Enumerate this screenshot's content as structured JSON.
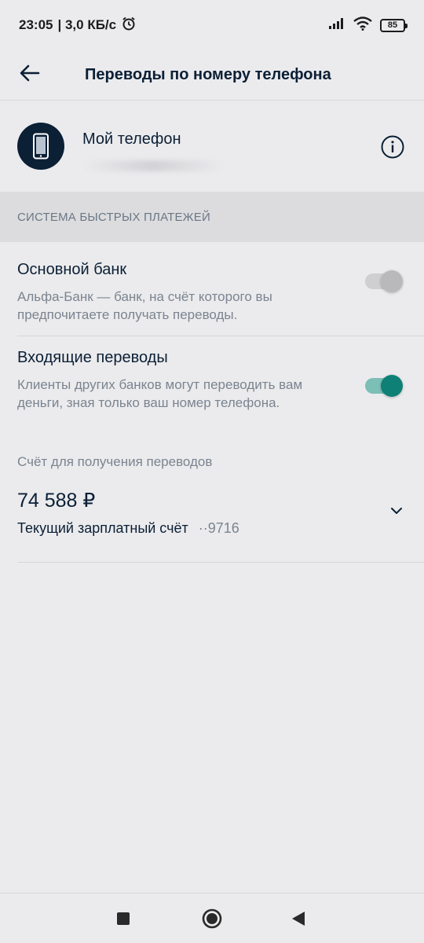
{
  "status_bar": {
    "time": "23:05",
    "speed": "| 3,0 КБ/с",
    "battery": "85",
    "icons": [
      "alarm-icon",
      "signal-icon",
      "wifi-icon",
      "battery-icon"
    ]
  },
  "header": {
    "title": "Переводы по номеру телефона",
    "back_icon": "arrow-left-icon"
  },
  "phone": {
    "title": "Мой телефон",
    "icon": "smartphone-icon",
    "info_icon": "info-icon"
  },
  "section": {
    "title": "СИСТЕМА БЫСТРЫХ ПЛАТЕЖЕЙ"
  },
  "settings": [
    {
      "title": "Основной банк",
      "description": "Альфа-Банк — банк, на счёт которого вы предпочитаете получать переводы.",
      "enabled": false
    },
    {
      "title": "Входящие переводы",
      "description": "Клиенты других банков могут переводить вам деньги, зная только ваш номер телефона.",
      "enabled": true
    }
  ],
  "account": {
    "label": "Счёт для получения переводов",
    "amount": "74 588 ₽",
    "name": "Текущий зарплатный счёт",
    "mask": "··9716"
  },
  "colors": {
    "accent": "#0f8075",
    "text": "#0b1f35",
    "secondary": "#7b8490",
    "background": "#ebebed"
  },
  "nav": [
    "recent-apps-icon",
    "home-icon",
    "back-icon"
  ]
}
